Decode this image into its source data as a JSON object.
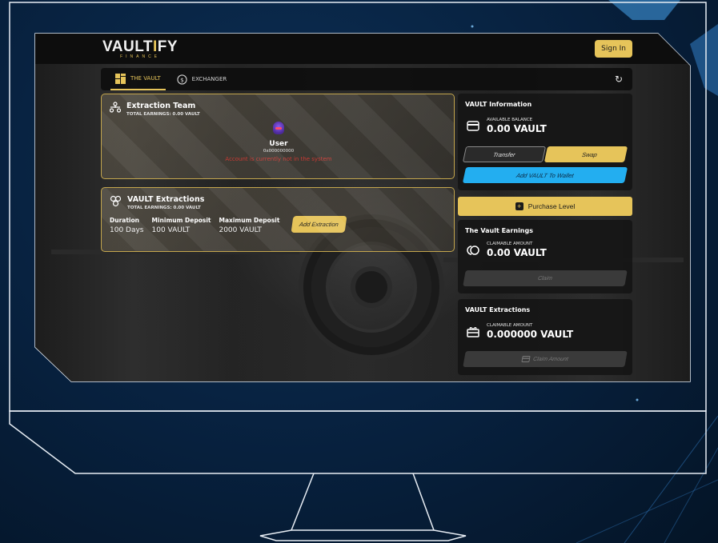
{
  "header": {
    "logo_main": "VAULT",
    "logo_accent": "I",
    "logo_end": "FY",
    "logo_sub": "FINANCE",
    "signin_label": "Sign In"
  },
  "tabs": [
    {
      "label": "THE VAULT",
      "icon": "grid-icon",
      "active": true
    },
    {
      "label": "EXCHANGER",
      "icon": "exchange-icon",
      "active": false
    }
  ],
  "team": {
    "title": "Extraction Team",
    "subtitle": "TOTAL EARNINGS: 0.00 VAULT",
    "user_name": "User",
    "user_address": "0x000000000",
    "warning": "Account is currently not in the system"
  },
  "extractions": {
    "title": "VAULT Extractions",
    "subtitle": "TOTAL EARNINGS: 0.00 VAULT",
    "columns": [
      {
        "header": "Duration",
        "value": "100 Days"
      },
      {
        "header": "Minimum Deposit",
        "value": "100 VAULT"
      },
      {
        "header": "Maximum Deposit",
        "value": "2000 VAULT"
      }
    ],
    "add_label": "Add Extraction"
  },
  "info": {
    "title": "VAULT Information",
    "balance_label": "AVAILABLE BALANCE",
    "balance_value": "0.00 VAULT",
    "transfer_label": "Transfer",
    "swap_label": "Swap",
    "add_wallet_label": "Add VAULT To Wallet"
  },
  "purchase_label": "Purchase Level",
  "earnings": {
    "title": "The Vault Earnings",
    "claimable_label": "CLAIMABLE AMOUNT",
    "claimable_value": "0.00 VAULT",
    "claim_label": "Claim"
  },
  "vault_extractions": {
    "title": "VAULT Extractions",
    "claimable_label": "CLAIMABLE AMOUNT",
    "claimable_value": "0.000000 VAULT",
    "claim_label": "Claim Amount"
  },
  "colors": {
    "gold": "#e6c45a",
    "blue": "#23aef0",
    "warning": "#c83a34",
    "background": "#07203d"
  }
}
